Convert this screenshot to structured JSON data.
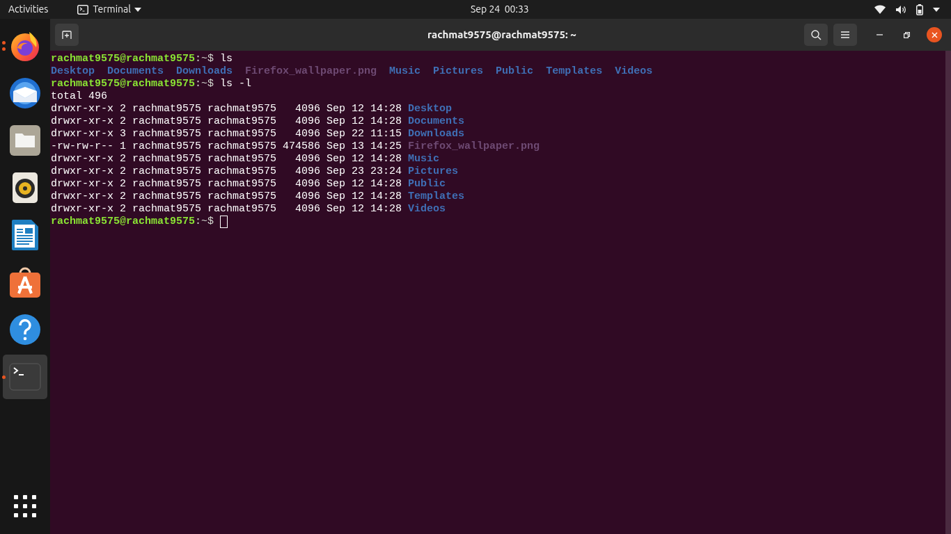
{
  "top_bar": {
    "activities": "Activities",
    "app_menu": "Terminal",
    "clock": "Sep 24  00:33"
  },
  "dock": {
    "apps": [
      {
        "kind": "firefox",
        "running": true,
        "multiple_windows": true,
        "selected": false
      },
      {
        "kind": "thunderbird",
        "running": false,
        "selected": false
      },
      {
        "kind": "files",
        "running": false,
        "selected": false
      },
      {
        "kind": "rhythmbox",
        "running": false,
        "selected": false
      },
      {
        "kind": "writer",
        "running": false,
        "selected": false
      },
      {
        "kind": "software",
        "running": false,
        "selected": false
      },
      {
        "kind": "help",
        "running": false,
        "selected": false
      },
      {
        "kind": "terminal",
        "running": true,
        "multiple_windows": false,
        "selected": true
      }
    ]
  },
  "window": {
    "title": "rachmat9575@rachmat9575: ~"
  },
  "terminal": {
    "lines": [
      {
        "kind": "prompt",
        "user_host": "rachmat9575@rachmat9575",
        "path": ":~$",
        "command": "ls"
      },
      {
        "kind": "listing",
        "entries": [
          {
            "name": "Desktop",
            "kind": "directory"
          },
          {
            "name": "Documents",
            "kind": "directory"
          },
          {
            "name": "Downloads",
            "kind": "directory"
          },
          {
            "name": "Firefox_wallpaper.png",
            "kind": "image"
          },
          {
            "name": "Music",
            "kind": "directory"
          },
          {
            "name": "Pictures",
            "kind": "directory"
          },
          {
            "name": "Public",
            "kind": "directory"
          },
          {
            "name": "Templates",
            "kind": "directory"
          },
          {
            "name": "Videos",
            "kind": "directory"
          }
        ]
      },
      {
        "kind": "prompt",
        "user_host": "rachmat9575@rachmat9575",
        "path": ":~$",
        "command": "ls -l"
      },
      {
        "kind": "text",
        "text": "total 496"
      },
      {
        "kind": "long",
        "info": "drwxr-xr-x 2 rachmat9575 rachmat9575   4096 Sep 12 14:28",
        "entry": {
          "name": "Desktop",
          "kind": "directory"
        }
      },
      {
        "kind": "long",
        "info": "drwxr-xr-x 2 rachmat9575 rachmat9575   4096 Sep 12 14:28",
        "entry": {
          "name": "Documents",
          "kind": "directory"
        }
      },
      {
        "kind": "long",
        "info": "drwxr-xr-x 3 rachmat9575 rachmat9575   4096 Sep 22 11:15",
        "entry": {
          "name": "Downloads",
          "kind": "directory"
        }
      },
      {
        "kind": "long",
        "info": "-rw-rw-r-- 1 rachmat9575 rachmat9575 474586 Sep 13 14:25",
        "entry": {
          "name": "Firefox_wallpaper.png",
          "kind": "image"
        }
      },
      {
        "kind": "long",
        "info": "drwxr-xr-x 2 rachmat9575 rachmat9575   4096 Sep 12 14:28",
        "entry": {
          "name": "Music",
          "kind": "directory"
        }
      },
      {
        "kind": "long",
        "info": "drwxr-xr-x 2 rachmat9575 rachmat9575   4096 Sep 23 23:24",
        "entry": {
          "name": "Pictures",
          "kind": "directory"
        }
      },
      {
        "kind": "long",
        "info": "drwxr-xr-x 2 rachmat9575 rachmat9575   4096 Sep 12 14:28",
        "entry": {
          "name": "Public",
          "kind": "directory"
        }
      },
      {
        "kind": "long",
        "info": "drwxr-xr-x 2 rachmat9575 rachmat9575   4096 Sep 12 14:28",
        "entry": {
          "name": "Templates",
          "kind": "directory"
        }
      },
      {
        "kind": "long",
        "info": "drwxr-xr-x 2 rachmat9575 rachmat9575   4096 Sep 12 14:28",
        "entry": {
          "name": "Videos",
          "kind": "directory"
        }
      },
      {
        "kind": "prompt",
        "user_host": "rachmat9575@rachmat9575",
        "path": ":~$",
        "cursor": true
      }
    ]
  }
}
